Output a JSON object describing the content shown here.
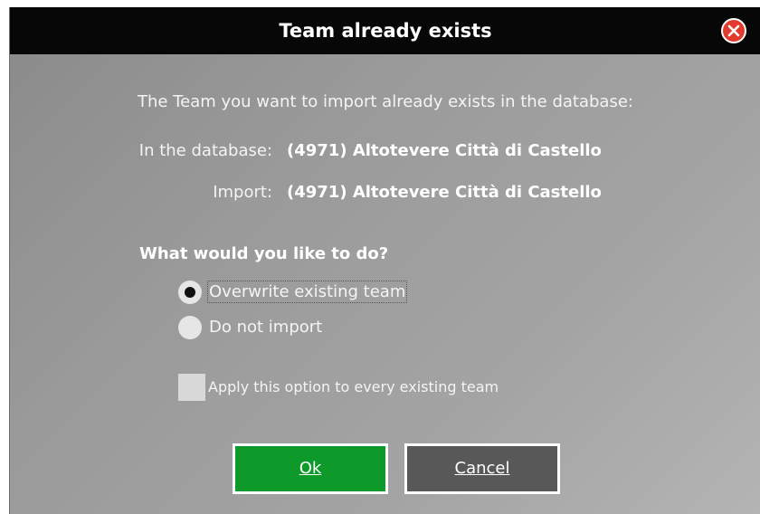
{
  "dialog": {
    "title": "Team already exists",
    "message": "The Team you want to import already exists in the database:",
    "rows": [
      {
        "label": "In the database:",
        "value": "(4971) Altotevere Città di Castello"
      },
      {
        "label": "Import:",
        "value": "(4971) Altotevere Città di Castello"
      }
    ],
    "question": "What would you like to do?",
    "options": [
      {
        "label": "Overwrite existing team",
        "selected": true
      },
      {
        "label": "Do not import",
        "selected": false
      }
    ],
    "apply_all": {
      "label": "Apply this option to every existing team",
      "checked": false
    },
    "buttons": {
      "ok": "Ok",
      "cancel": "Cancel"
    },
    "colors": {
      "titlebar": "#070707",
      "ok_button": "#0d9a2b",
      "cancel_button": "#585858",
      "close_icon": "#e23b2e"
    }
  }
}
